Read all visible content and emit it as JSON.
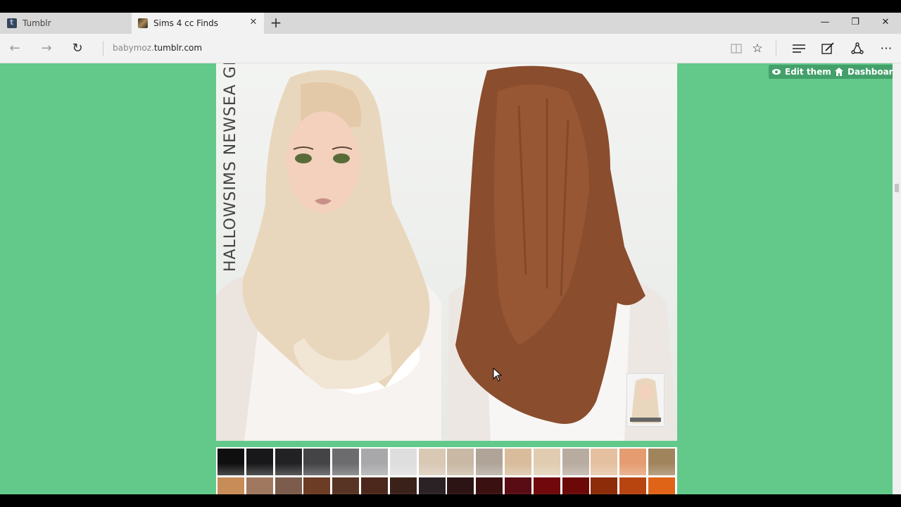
{
  "browser": {
    "tabs": [
      {
        "label": "Tumblr",
        "icon": "tumblr-icon",
        "active": false
      },
      {
        "label": "Sims 4 cc Finds",
        "icon": "sims-favicon-icon",
        "active": true
      }
    ],
    "url_prefix": "babymoz.",
    "url_host": "tumblr.com"
  },
  "page": {
    "background_color": "#62c98b",
    "image_caption": "HALLOWSIMS NEWSEA GISELE",
    "controls": {
      "edit_theme_label": "Edit theme",
      "dashboard_label": "Dashboard"
    }
  },
  "swatches": {
    "row1": [
      "#0f0f10",
      "#18181a",
      "#222224",
      "#444446",
      "#6c6c6e",
      "#a8a8aa",
      "#dedede",
      "#d8c8b4",
      "#c8b8a4",
      "#b0a498",
      "#d8bc9c",
      "#e0ccb0",
      "#b8aca0",
      "#e4c0a0",
      "#e49c70",
      "#a0845c"
    ],
    "row2": [
      "#c88c58",
      "#a07860",
      "#7c5c4c",
      "#6c3c24",
      "#583424",
      "#4c281c",
      "#3a221a",
      "#2a2224",
      "#2c1414",
      "#3a1010",
      "#5a0c14",
      "#70080c",
      "#6c0808",
      "#8c2c08",
      "#b84410",
      "#e06418"
    ]
  }
}
